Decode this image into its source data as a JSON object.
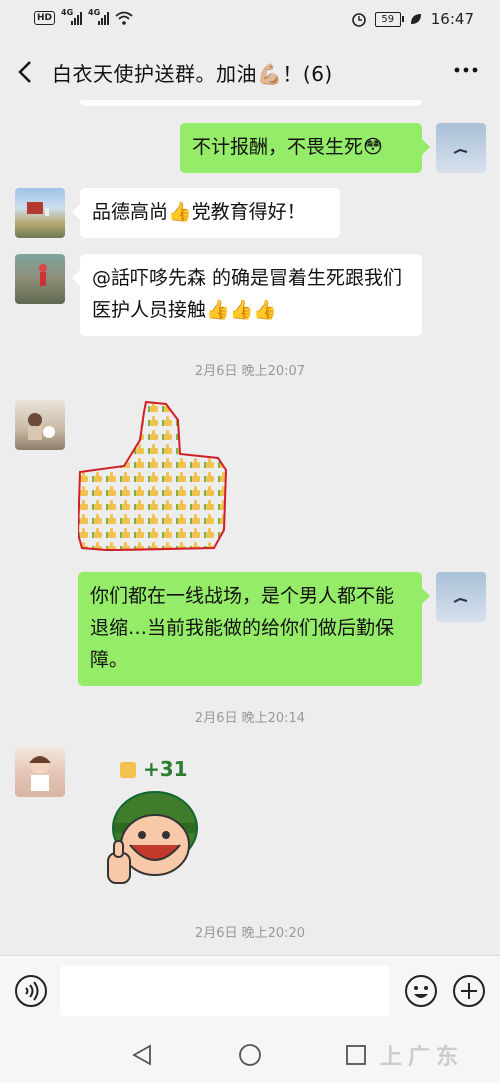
{
  "status_bar": {
    "hd_label": "HD",
    "sim1": "4G",
    "sim2": "4G",
    "battery": "59",
    "time": "16:47"
  },
  "header": {
    "title": "白衣天使护送群。加油💪🏼！(6)",
    "back_icon": "chevron-left-icon",
    "more_icon": "more-dots-icon"
  },
  "messages": [
    {
      "side": "right",
      "text": "不计报酬，不畏生死😳"
    },
    {
      "side": "left",
      "text": "品德高尚👍党教育得好！"
    },
    {
      "side": "left",
      "text": "@話吓哆先森  的确是冒着生死跟我们医护人员接触👍👍👍"
    },
    {
      "side": "left",
      "sticker": "thumbs-up-sticker"
    },
    {
      "side": "right",
      "text": "你们都在一线战场，是个男人都不能退缩…当前我能做的给你们做后勤保障。"
    },
    {
      "side": "left",
      "sticker": "soldier-thumbs-up-sticker",
      "sticker_text": "+31"
    }
  ],
  "timestamps": [
    "2月6日 晚上20:07",
    "2月6日 晚上20:14",
    "2月6日 晚上20:20"
  ],
  "input_bar": {
    "voice_icon": "voice-icon",
    "emoji_icon": "emoji-icon",
    "add_icon": "plus-icon"
  },
  "nav_bar": {
    "back": "nav-back-icon",
    "home": "nav-home-icon",
    "recent": "nav-recent-icon"
  },
  "watermark": "上广东"
}
